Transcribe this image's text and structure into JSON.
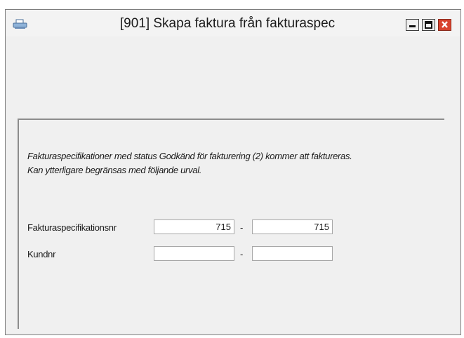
{
  "window": {
    "title": "[901]  Skapa faktura från fakturaspec",
    "icon": "printer-icon"
  },
  "title_controls": [
    "minimize-icon",
    "maximize-icon",
    "close-icon"
  ],
  "info": {
    "line1": "Fakturaspecifikationer med status Godkänd för fakturering (2) kommer att faktureras.",
    "line2": "Kan ytterligare begränsas med följande urval."
  },
  "rows": [
    {
      "label": "Fakturaspecifikationsnr",
      "from": "715",
      "separator": "-",
      "to": "715"
    },
    {
      "label": "Kundnr",
      "from": "",
      "separator": "-",
      "to": ""
    }
  ],
  "colors": {
    "close_button": "#d8432e",
    "panel_border": "#8c8c8c",
    "window_bg": "#f0f0f0"
  }
}
